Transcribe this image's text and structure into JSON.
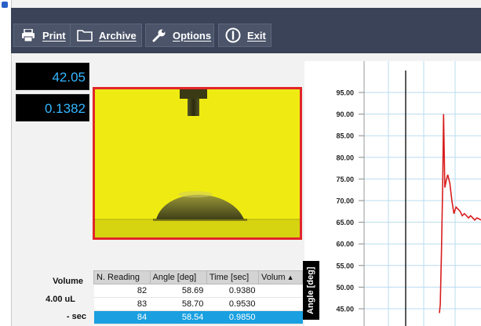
{
  "toolbar": {
    "print": "Print",
    "archive": "Archive",
    "options": "Options",
    "exit": "Exit"
  },
  "readouts": [
    "42.05",
    "0.1382"
  ],
  "labels": {
    "volume": "Volume",
    "volume_value": "4.00 uL",
    "sec": "- sec"
  },
  "table": {
    "headers": [
      "N. Reading",
      "Angle [deg]",
      "Time [sec]",
      "Volum"
    ],
    "rows": [
      {
        "n": "82",
        "angle": "58.69",
        "time": "0.9380",
        "selected": false
      },
      {
        "n": "83",
        "angle": "58.70",
        "time": "0.9530",
        "selected": false
      },
      {
        "n": "84",
        "angle": "58.54",
        "time": "0.9850",
        "selected": true
      }
    ]
  },
  "colors": {
    "toolbar_bg": "#3a4357",
    "readout_text": "#35b7ff",
    "camera_bg": "#efeb12",
    "camera_border": "#e1262a",
    "selection": "#1aa0e0",
    "chart_line": "#d81e1e"
  },
  "icons": {
    "print": "printer-icon",
    "archive": "folder-icon",
    "options": "wrench-icon",
    "exit": "power-icon",
    "sort": "chevron-up-icon"
  },
  "chart_data": {
    "type": "line",
    "ylabel": "Angle [deg]",
    "yticks": [
      "95.00",
      "90.00",
      "85.00",
      "80.00",
      "75.00",
      "70.00",
      "65.00",
      "60.00",
      "55.00",
      "50.00",
      "45.00"
    ],
    "ylim": [
      42,
      99
    ],
    "grid": true,
    "series": [
      {
        "x": [
          0.0,
          0.02,
          0.05,
          0.08,
          0.1,
          0.13,
          0.16,
          0.2,
          0.25,
          0.3,
          0.35,
          0.4,
          0.45,
          0.5,
          0.55,
          0.6,
          0.65,
          0.7,
          0.75,
          0.8,
          0.85,
          0.9,
          0.95,
          1.0
        ],
        "y": [
          44,
          46,
          58,
          74,
          90,
          73,
          74.5,
          76,
          74,
          70,
          67,
          68.5,
          68,
          67.5,
          66.5,
          67,
          66.5,
          66,
          66.5,
          66,
          65.5,
          66,
          65.8,
          65.5
        ]
      }
    ]
  }
}
